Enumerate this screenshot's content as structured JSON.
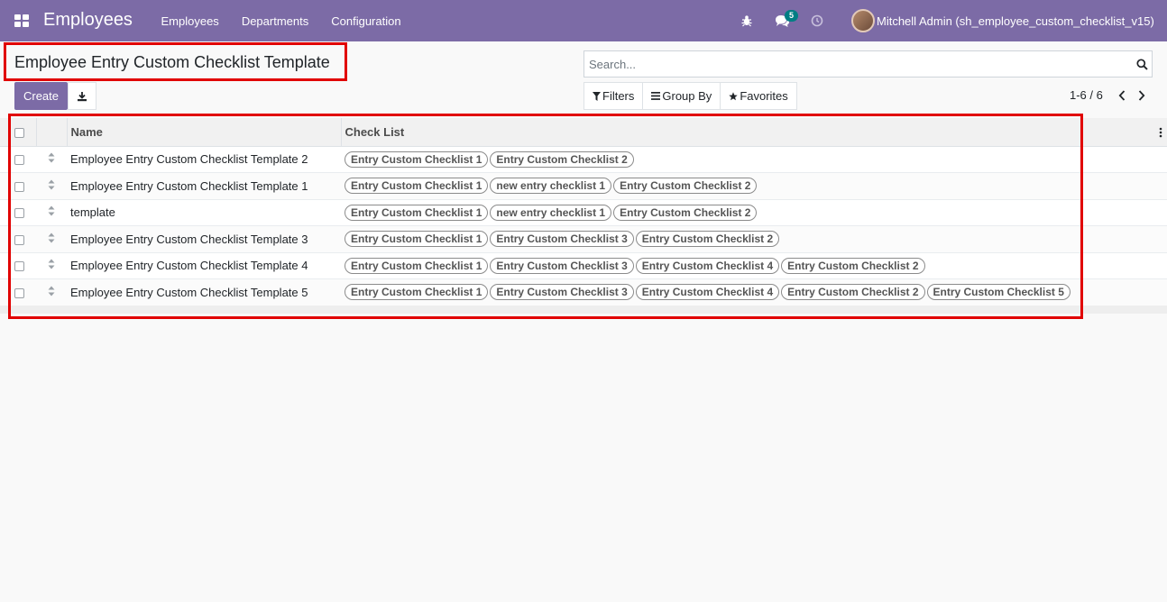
{
  "navbar": {
    "brand": "Employees",
    "menu": [
      "Employees",
      "Departments",
      "Configuration"
    ],
    "message_count": "5",
    "user_name": "Mitchell Admin (sh_employee_custom_checklist_v15)"
  },
  "control": {
    "breadcrumb": "Employee Entry Custom Checklist Template",
    "create_label": "Create",
    "search_placeholder": "Search...",
    "filters_label": "Filters",
    "groupby_label": "Group By",
    "favorites_label": "Favorites",
    "pager": "1-6 / 6"
  },
  "list": {
    "headers": {
      "name": "Name",
      "checklist": "Check List"
    },
    "rows": [
      {
        "name": "Employee Entry Custom Checklist Template 2",
        "tags": [
          "Entry Custom Checklist 1",
          "Entry Custom Checklist 2"
        ]
      },
      {
        "name": "Employee Entry Custom Checklist Template 1",
        "tags": [
          "Entry Custom Checklist 1",
          "new entry checklist 1",
          "Entry Custom Checklist 2"
        ]
      },
      {
        "name": "template",
        "tags": [
          "Entry Custom Checklist 1",
          "new entry checklist 1",
          "Entry Custom Checklist 2"
        ]
      },
      {
        "name": "Employee Entry Custom Checklist Template 3",
        "tags": [
          "Entry Custom Checklist 1",
          "Entry Custom Checklist 3",
          "Entry Custom Checklist 2"
        ]
      },
      {
        "name": "Employee Entry Custom Checklist Template 4",
        "tags": [
          "Entry Custom Checklist 1",
          "Entry Custom Checklist 3",
          "Entry Custom Checklist 4",
          "Entry Custom Checklist 2"
        ]
      },
      {
        "name": "Employee Entry Custom Checklist Template 5",
        "tags": [
          "Entry Custom Checklist 1",
          "Entry Custom Checklist 3",
          "Entry Custom Checklist 4",
          "Entry Custom Checklist 2",
          "Entry Custom Checklist 5"
        ]
      }
    ]
  },
  "colors": {
    "navbar": "#7c6ba6",
    "highlight": "#e10000",
    "badge": "#017e84"
  },
  "icons": [
    "apps-icon",
    "bug-icon",
    "chat-icon",
    "clock-icon",
    "download-icon",
    "search-icon",
    "filter-icon",
    "list-icon",
    "star-icon",
    "chevron-left-icon",
    "chevron-right-icon",
    "sort-handle-icon",
    "more-options-icon"
  ]
}
